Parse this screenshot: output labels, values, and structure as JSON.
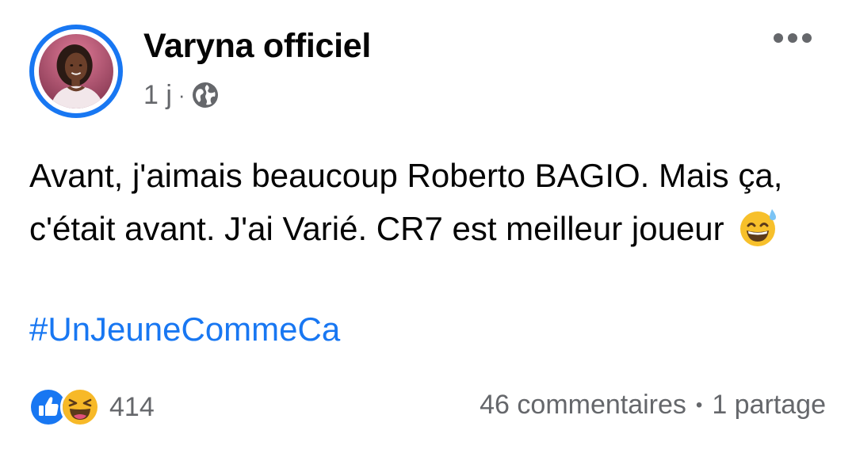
{
  "post": {
    "author": "Varyna officiel",
    "time": "1 j",
    "separator": "·",
    "audience_icon": "globe-icon",
    "body": "Avant, j'aimais beaucoup Roberto BAGIO. Mais ça, c'était avant. J'ai Varié. CR7 est meilleur joueur",
    "body_emoji": "grinning-sweat-emoji",
    "hashtag": "#UnJeuneCommeCa"
  },
  "footer": {
    "reaction_icons": [
      "like-icon",
      "haha-icon"
    ],
    "reaction_count": "414",
    "comments": "46 commentaires",
    "dot": "•",
    "shares": "1 partage"
  },
  "colors": {
    "accent": "#1877f2",
    "text": "#050505",
    "secondary": "#65676b",
    "haha": "#f7b928"
  }
}
